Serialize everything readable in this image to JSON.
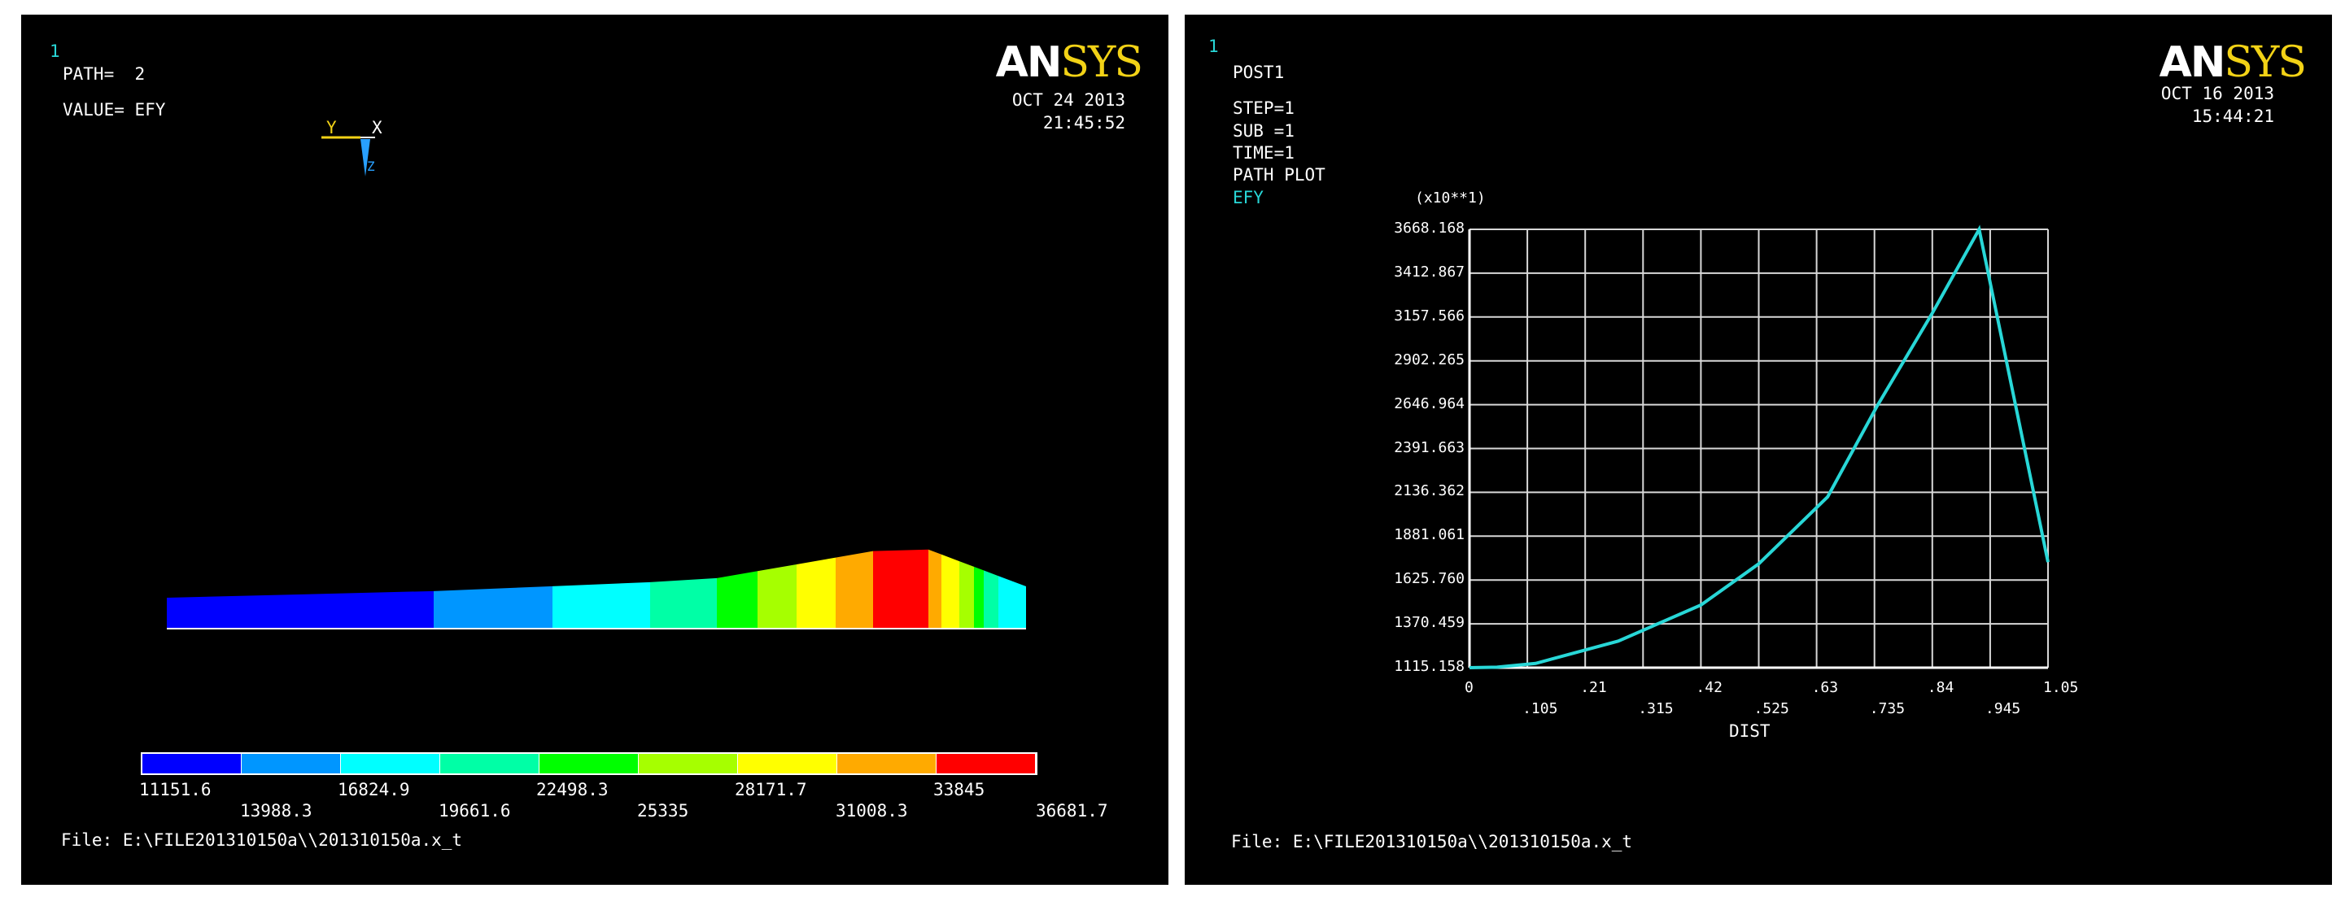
{
  "left": {
    "window_number": "1",
    "logo_prefix": "AN",
    "logo_suffix": "SYS",
    "path_line": "PATH=  2",
    "value_line": "VALUE= EFY",
    "date": "OCT 24 2013",
    "time": "21:45:52",
    "triad_y": "Y",
    "triad_x": "X",
    "triad_z": "Z",
    "file": "File: E:\\FILE201310150a\\\\201310150a.x_t",
    "legend_colors": [
      "#0000ff",
      "#0096ff",
      "#00ffff",
      "#00ffa6",
      "#00ff00",
      "#a6ff00",
      "#ffff00",
      "#ffaa00",
      "#ff0000"
    ],
    "legend_labels_top": [
      "11151.6",
      "16824.9",
      "22498.3",
      "28171.7",
      "33845"
    ],
    "legend_labels_bottom": [
      "13988.3",
      "19661.6",
      "25335",
      "31008.3",
      "36681.7"
    ]
  },
  "right": {
    "window_number": "1",
    "logo_prefix": "AN",
    "logo_suffix": "SYS",
    "post": "POST1",
    "step": "STEP=1",
    "sub": "SUB =1",
    "time_label": "TIME=1",
    "path_plot": "PATH PLOT",
    "series_label": "EFY",
    "date": "OCT 16 2013",
    "time": "15:44:21",
    "multiplier": "(x10**1)",
    "file": "File: E:\\FILE201310150a\\\\201310150a.x_t",
    "line_color": "#28d7d7"
  },
  "chart_data": {
    "type": "line",
    "xlabel": "DIST",
    "ylabel": "",
    "xlim": [
      0,
      1.05
    ],
    "ylim": [
      1115.158,
      3668.168
    ],
    "x_ticks": [
      "0",
      ".105",
      ".21",
      ".315",
      ".42",
      ".525",
      ".63",
      ".735",
      ".84",
      ".945",
      "1.05"
    ],
    "y_ticks": [
      "1115.158",
      "1370.459",
      "1625.760",
      "1881.061",
      "2136.362",
      "2391.663",
      "2646.964",
      "2902.265",
      "3157.566",
      "3412.867",
      "3668.168"
    ],
    "grid": true,
    "series": [
      {
        "x": [
          0,
          0.05,
          0.12,
          0.27,
          0.42,
          0.525,
          0.65,
          0.74,
          0.84,
          0.925,
          1.05
        ],
        "y": [
          1115.158,
          1118,
          1140,
          1270,
          1480,
          1720,
          2110,
          2640,
          3180,
          3668.168,
          1730
        ]
      }
    ]
  }
}
